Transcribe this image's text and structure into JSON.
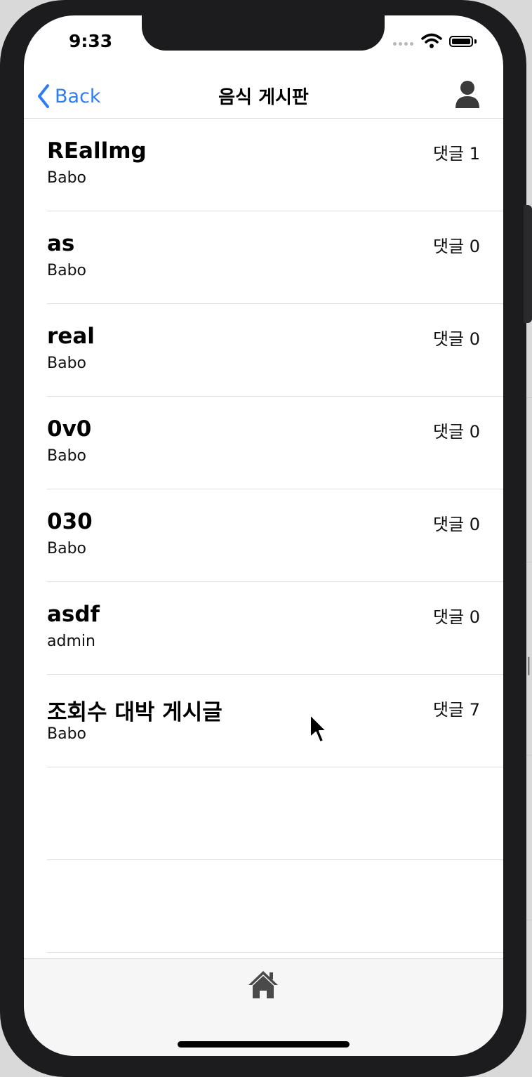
{
  "status_bar": {
    "time": "9:33"
  },
  "nav": {
    "back_label": "Back",
    "title": "음식 게시판"
  },
  "posts": [
    {
      "title": "REallmg",
      "author": "Babo",
      "comments": "댓글 1"
    },
    {
      "title": "as",
      "author": "Babo",
      "comments": "댓글 0"
    },
    {
      "title": "real",
      "author": "Babo",
      "comments": "댓글 0"
    },
    {
      "title": "0v0",
      "author": "Babo",
      "comments": "댓글 0"
    },
    {
      "title": "030",
      "author": "Babo",
      "comments": "댓글 0"
    },
    {
      "title": "asdf",
      "author": "admin",
      "comments": "댓글 0"
    },
    {
      "title": "조회수 대박 게시글",
      "author": "Babo",
      "comments": "댓글 7"
    }
  ],
  "icons": {
    "back": "chevron-left-icon",
    "profile": "person-icon",
    "home": "home-icon",
    "wifi": "wifi-icon",
    "battery": "battery-icon"
  },
  "colors": {
    "accent": "#2f7cf6",
    "background": "#ffffff",
    "tabbar": "#f6f6f6"
  }
}
